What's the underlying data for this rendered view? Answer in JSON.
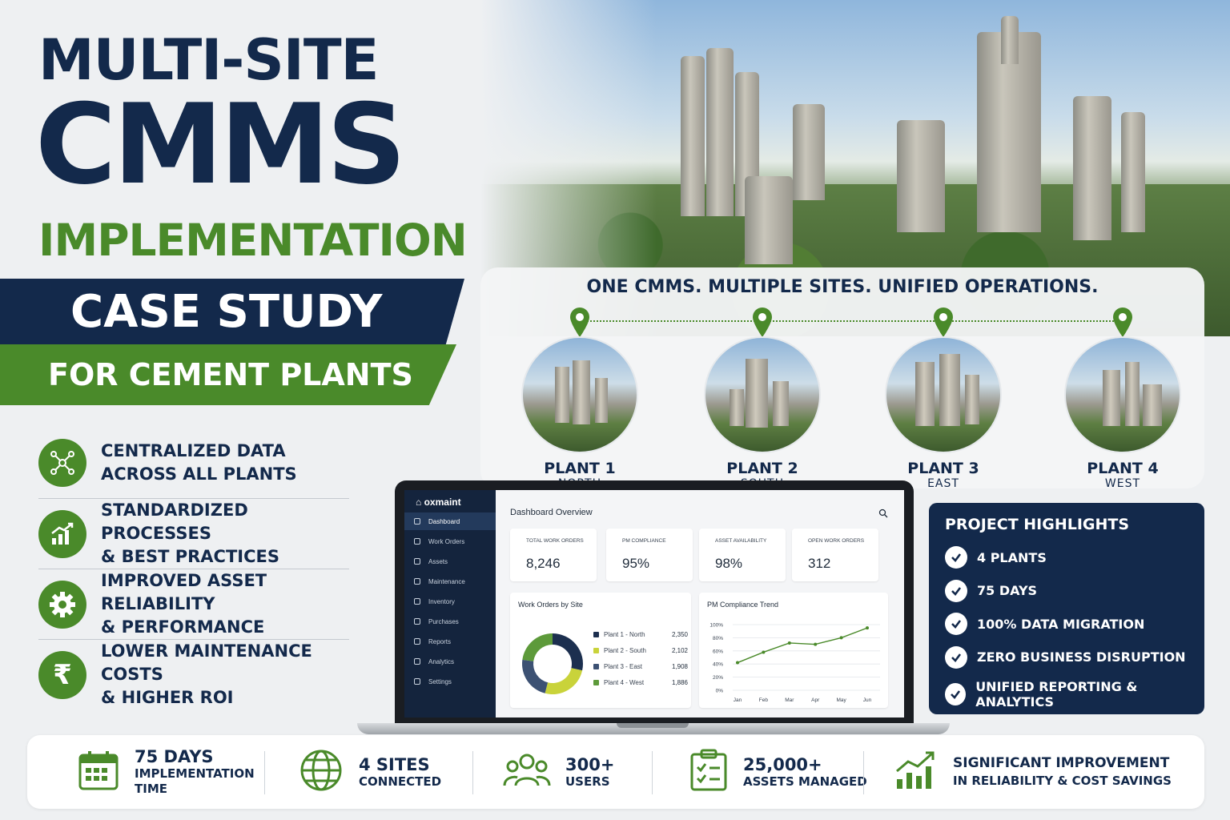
{
  "title": {
    "line1": "MULTI-SITE",
    "line2": "CMMS",
    "line3": "IMPLEMENTATION",
    "band1": "CASE STUDY",
    "band2": "FOR CEMENT PLANTS"
  },
  "benefits": [
    {
      "icon": "network-icon",
      "line1": "CENTRALIZED DATA",
      "line2": "ACROSS ALL PLANTS"
    },
    {
      "icon": "growth-chart-icon",
      "line1": "STANDARDIZED PROCESSES",
      "line2": "& BEST PRACTICES"
    },
    {
      "icon": "gear-icon",
      "line1": "IMPROVED ASSET RELIABILITY",
      "line2": "& PERFORMANCE"
    },
    {
      "icon": "rupee-icon",
      "line1": "LOWER MAINTENANCE COSTS",
      "line2": "& HIGHER ROI"
    }
  ],
  "plants_panel": {
    "heading": "ONE CMMS. MULTIPLE SITES. UNIFIED OPERATIONS.",
    "plants": [
      {
        "name": "PLANT 1",
        "location": "NORTH"
      },
      {
        "name": "PLANT 2",
        "location": "SOUTH"
      },
      {
        "name": "PLANT 3",
        "location": "EAST"
      },
      {
        "name": "PLANT 4",
        "location": "WEST"
      }
    ]
  },
  "dashboard": {
    "logo": "oxmaint",
    "menu": [
      "Dashboard",
      "Work Orders",
      "Assets",
      "Maintenance",
      "Inventory",
      "Purchases",
      "Reports",
      "Analytics",
      "Settings"
    ],
    "active_menu": "Dashboard",
    "title": "Dashboard Overview",
    "kpis": [
      {
        "label": "TOTAL WORK ORDERS",
        "value": "8,246"
      },
      {
        "label": "PM COMPLIANCE",
        "value": "95%"
      },
      {
        "label": "ASSET AVAILABILITY",
        "value": "98%"
      },
      {
        "label": "OPEN WORK ORDERS",
        "value": "312"
      }
    ],
    "donut_title": "Work Orders by Site",
    "trend_title": "PM Compliance Trend"
  },
  "chart_data": [
    {
      "type": "pie",
      "title": "Work Orders by Site",
      "categories": [
        "Plant 1 - North",
        "Plant 2 - South",
        "Plant 3 - East",
        "Plant 4 - West"
      ],
      "values": [
        2350,
        2102,
        1908,
        1886
      ],
      "value_labels": [
        "2,350",
        "2,102",
        "1,908",
        "1,886"
      ],
      "colors": [
        "#1c2f4f",
        "#c9d33a",
        "#3c5173",
        "#5d9a3a"
      ]
    },
    {
      "type": "line",
      "title": "PM Compliance Trend",
      "categories": [
        "Jan",
        "Feb",
        "Mar",
        "Apr",
        "May",
        "Jun"
      ],
      "values": [
        42,
        58,
        72,
        70,
        80,
        95
      ],
      "yticks": [
        "100%",
        "80%",
        "60%",
        "40%",
        "20%",
        "0%"
      ],
      "ylim": [
        0,
        100
      ],
      "grid": true,
      "color": "#4a8a2a"
    }
  ],
  "highlights": {
    "title": "PROJECT HIGHLIGHTS",
    "items": [
      "4 PLANTS",
      "75 DAYS",
      "100% DATA MIGRATION",
      "ZERO BUSINESS DISRUPTION",
      "UNIFIED REPORTING & ANALYTICS"
    ]
  },
  "stats": [
    {
      "icon": "calendar-icon",
      "big": "75 DAYS",
      "line1": "IMPLEMENTATION",
      "line2": "TIME"
    },
    {
      "icon": "globe-icon",
      "big": "4 SITES",
      "line1": "CONNECTED",
      "line2": ""
    },
    {
      "icon": "users-icon",
      "big": "300+",
      "line1": "USERS",
      "line2": ""
    },
    {
      "icon": "checklist-icon",
      "big": "25,000+",
      "line1": "ASSETS MANAGED",
      "line2": ""
    },
    {
      "icon": "trend-up-icon",
      "big": "SIGNIFICANT IMPROVEMENT",
      "line1": "IN RELIABILITY & COST SAVINGS",
      "line2": ""
    }
  ],
  "colors": {
    "navy": "#13294b",
    "green": "#4a8a2a"
  }
}
